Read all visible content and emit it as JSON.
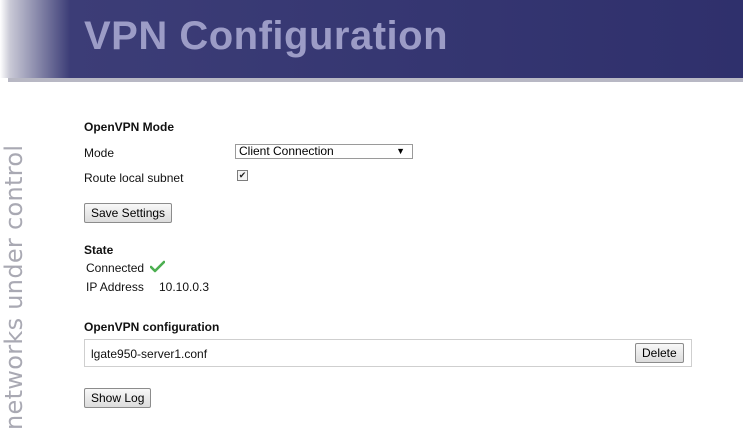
{
  "header": {
    "title": "VPN Configuration"
  },
  "sidebar": {
    "brand_text": "networks under control"
  },
  "mode_section": {
    "title": "OpenVPN Mode",
    "mode_label": "Mode",
    "mode_selected": "Client Connection",
    "route_label": "Route local subnet",
    "route_checked": true,
    "save_button": "Save Settings"
  },
  "state_section": {
    "title": "State",
    "status": "Connected",
    "ip_label": "IP Address",
    "ip_value": "10.10.0.3"
  },
  "config_section": {
    "title": "OpenVPN configuration",
    "files": [
      {
        "name": "lgate950-server1.conf",
        "delete_label": "Delete"
      }
    ],
    "show_log_button": "Show Log"
  },
  "colors": {
    "header_bg": "#2f306c",
    "title_text": "#9c9cc6",
    "connected_check": "#4caf50"
  }
}
